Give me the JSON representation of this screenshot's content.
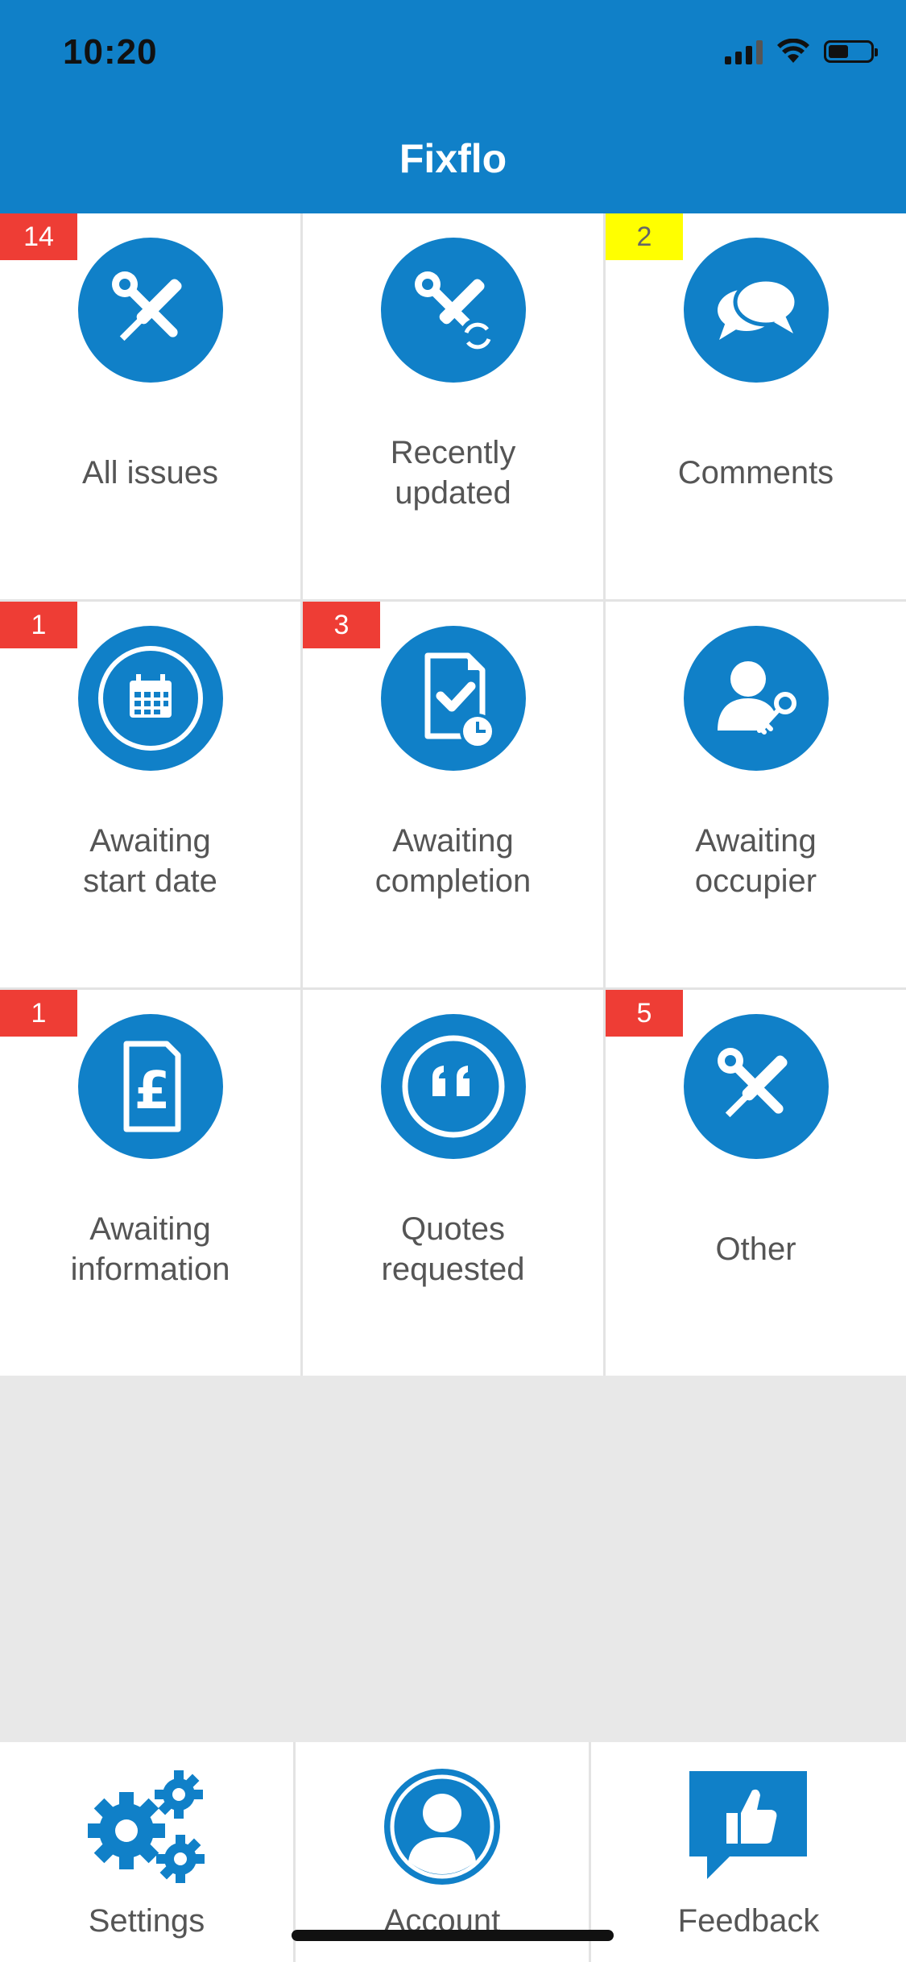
{
  "status_bar": {
    "time": "10:20"
  },
  "header": {
    "title": "Fixflo"
  },
  "tiles": [
    {
      "label_line1": "All issues",
      "label_line2": "",
      "badge": "14",
      "icon": "wrench-screwdriver-icon"
    },
    {
      "label_line1": "Recently",
      "label_line2": "updated",
      "badge": "",
      "icon": "wrench-refresh-icon"
    },
    {
      "label_line1": "Comments",
      "label_line2": "",
      "badge": "2",
      "icon": "speech-bubbles-icon"
    },
    {
      "label_line1": "Awaiting",
      "label_line2": "start date",
      "badge": "1",
      "icon": "calendar-icon"
    },
    {
      "label_line1": "Awaiting",
      "label_line2": "completion",
      "badge": "3",
      "icon": "document-check-clock-icon"
    },
    {
      "label_line1": "Awaiting",
      "label_line2": "occupier",
      "badge": "",
      "icon": "person-key-icon"
    },
    {
      "label_line1": "Awaiting",
      "label_line2": "information",
      "badge": "1",
      "icon": "pound-document-icon"
    },
    {
      "label_line1": "Quotes",
      "label_line2": "requested",
      "badge": "",
      "icon": "quote-icon"
    },
    {
      "label_line1": "Other",
      "label_line2": "",
      "badge": "5",
      "icon": "wrench-screwdriver-icon"
    }
  ],
  "bottom_nav": [
    {
      "label": "Settings",
      "icon": "gears-icon"
    },
    {
      "label": "Account",
      "icon": "account-icon"
    },
    {
      "label": "Feedback",
      "icon": "thumbs-up-bubble-icon"
    }
  ],
  "colors": {
    "brand": "#1080c8",
    "badge_red": "#ee3d35",
    "badge_yellow": "#ffff00"
  }
}
